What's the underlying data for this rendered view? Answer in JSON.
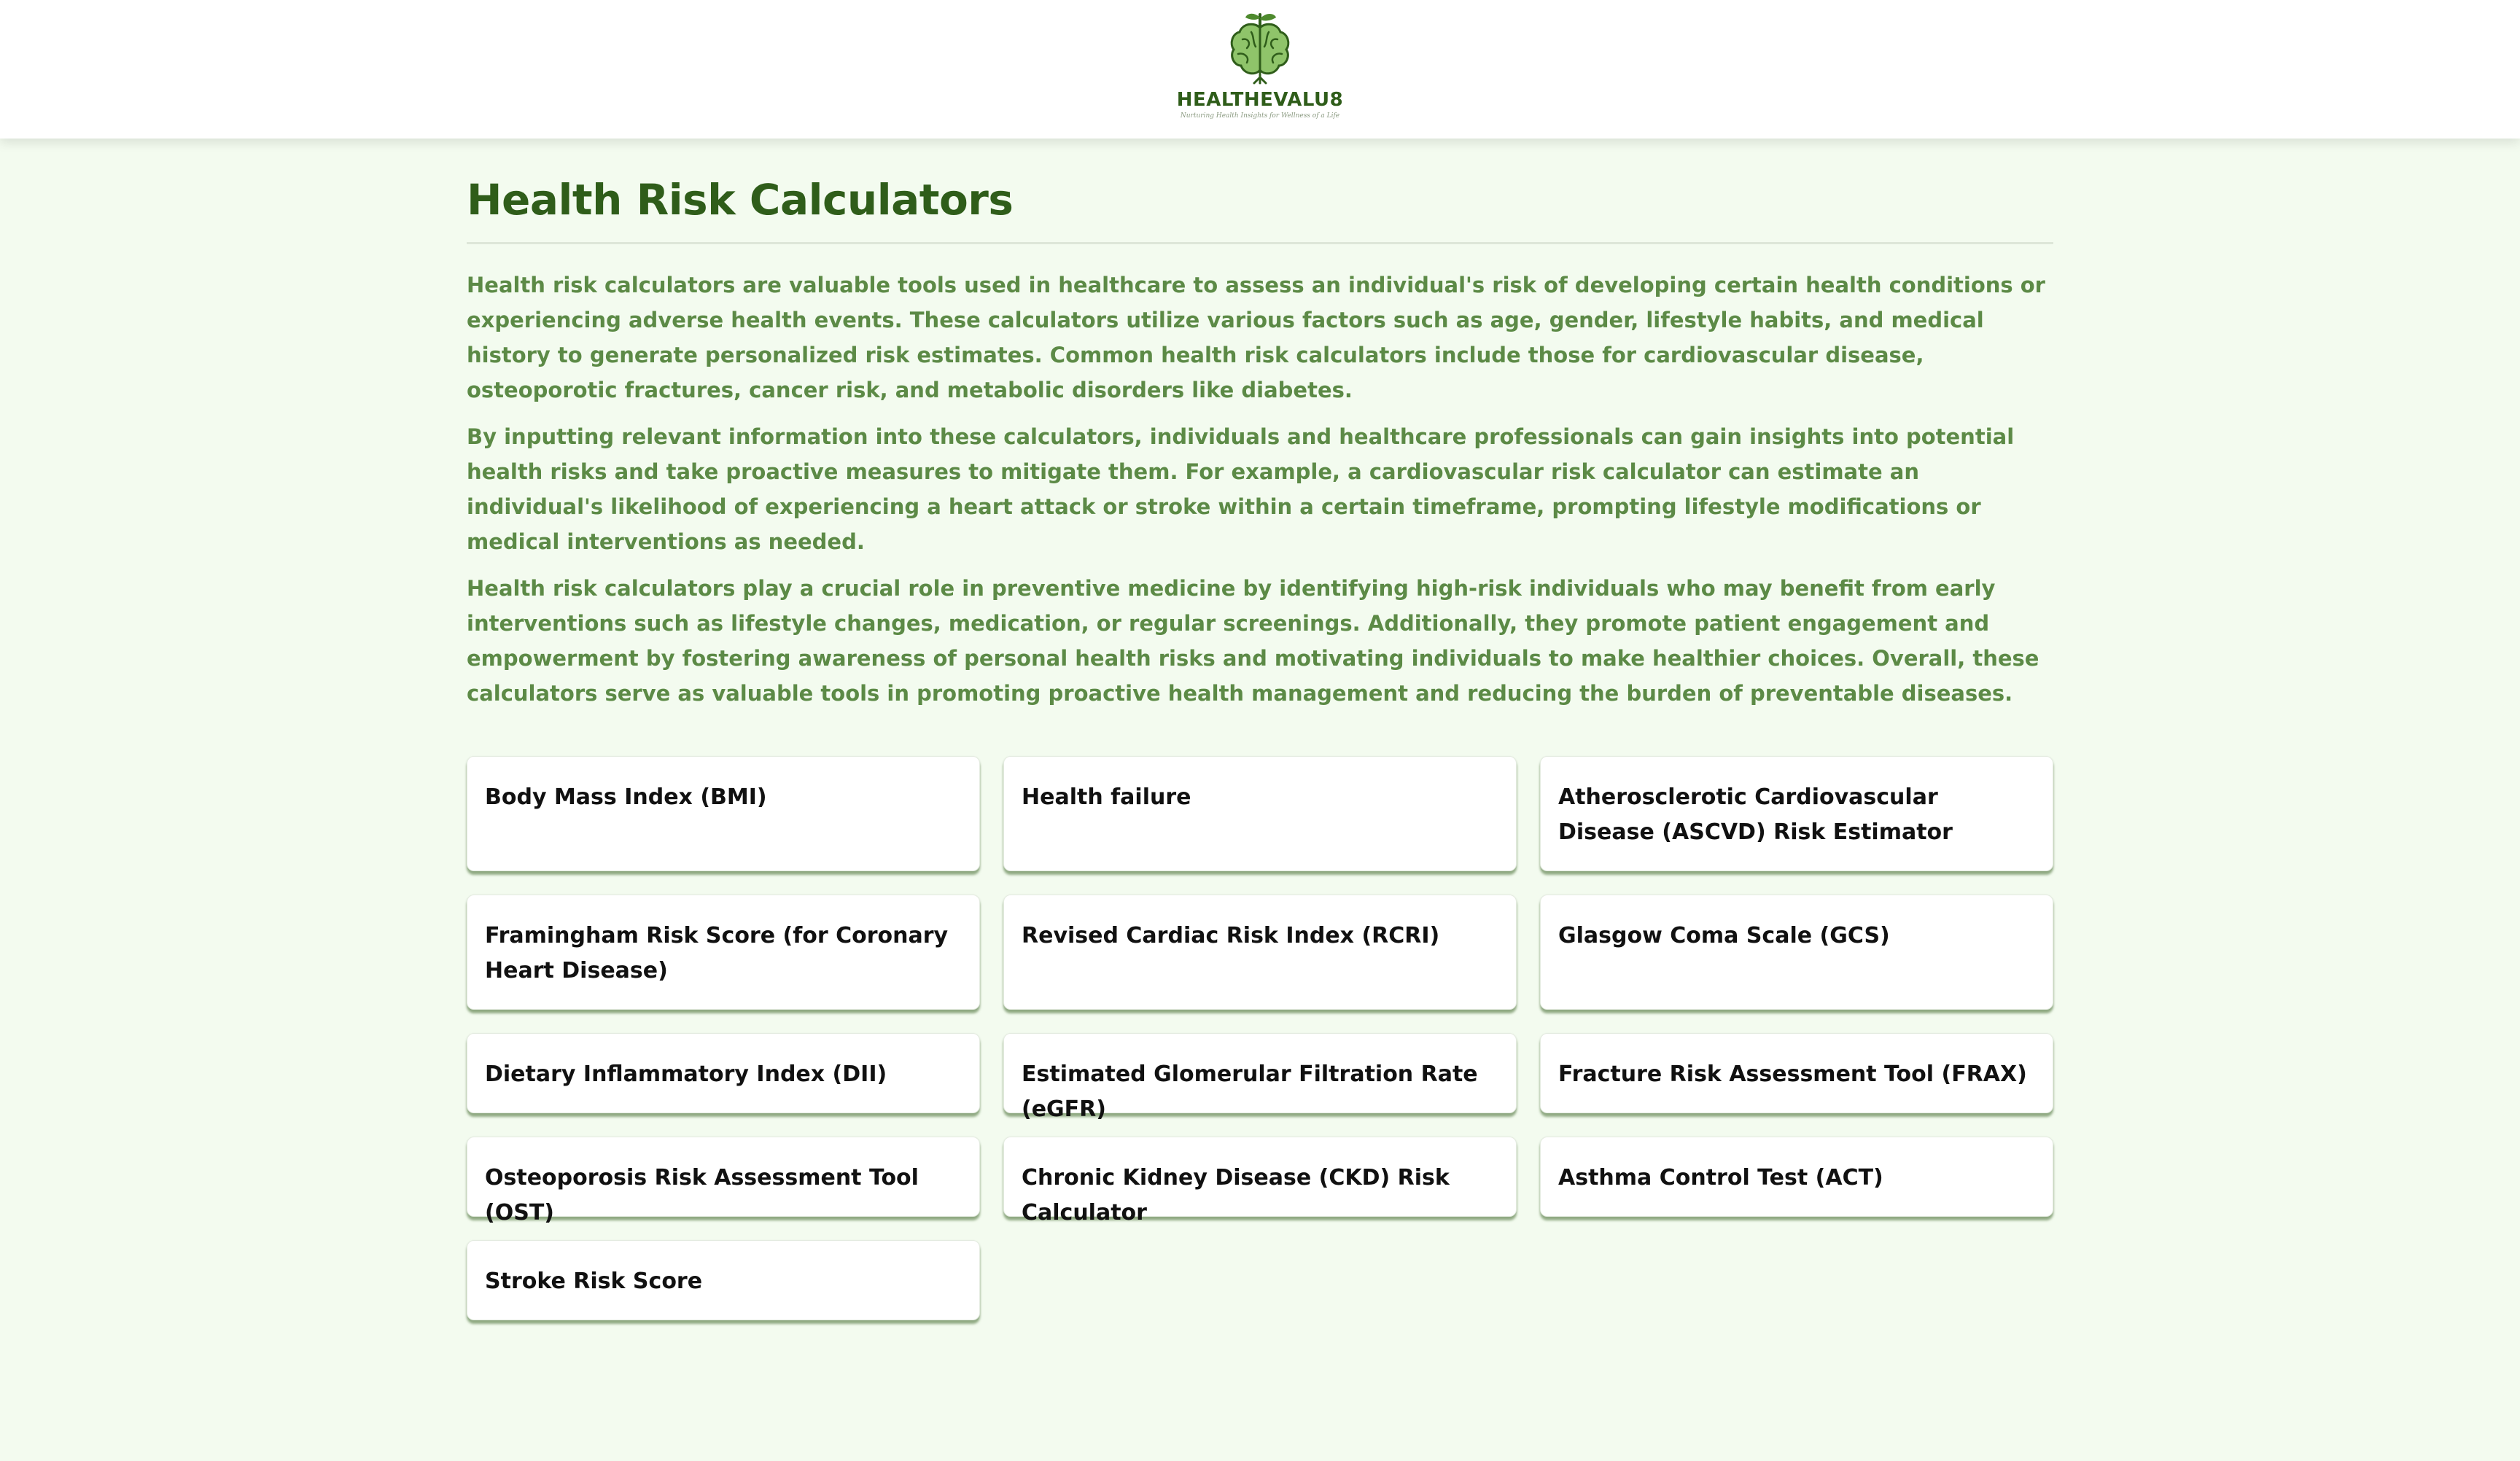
{
  "header": {
    "logo_name": "HEALTHEVALU8",
    "logo_tagline": "Nurturing Health Insights for Wellness of a Life"
  },
  "main": {
    "title": "Health Risk Calculators",
    "intro": [
      "Health risk calculators are valuable tools used in healthcare to assess an individual's risk of developing certain health conditions or experiencing adverse health events. These calculators utilize various factors such as age, gender, lifestyle habits, and medical history to generate personalized risk estimates. Common health risk calculators include those for cardiovascular disease, osteoporotic fractures, cancer risk, and metabolic disorders like diabetes.",
      "By inputting relevant information into these calculators, individuals and healthcare professionals can gain insights into potential health risks and take proactive measures to mitigate them. For example, a cardiovascular risk calculator can estimate an individual's likelihood of experiencing a heart attack or stroke within a certain timeframe, prompting lifestyle modifications or medical interventions as needed.",
      "Health risk calculators play a crucial role in preventive medicine by identifying high-risk individuals who may benefit from early interventions such as lifestyle changes, medication, or regular screenings. Additionally, they promote patient engagement and empowerment by fostering awareness of personal health risks and motivating individuals to make healthier choices. Overall, these calculators serve as valuable tools in promoting proactive health management and reducing the burden of preventable diseases."
    ],
    "calculators": [
      "Body Mass Index (BMI)",
      "Health failure",
      "Atherosclerotic Cardiovascular Disease (ASCVD) Risk Estimator",
      "Framingham Risk Score (for Coronary Heart Disease)",
      "Revised Cardiac Risk Index (RCRI)",
      "Glasgow Coma Scale (GCS)",
      "Dietary Inflammatory Index (DII)",
      "Estimated Glomerular Filtration Rate (eGFR)",
      "Fracture Risk Assessment Tool (FRAX)",
      "Osteoporosis Risk Assessment Tool (OST)",
      "Chronic Kidney Disease (CKD) Risk Calculator",
      "Asthma Control Test (ACT)",
      "Stroke Risk Score"
    ]
  },
  "colors": {
    "page_background": "#f3fbef",
    "brand_green": "#2f5d1a",
    "body_text_green": "#5c8a46",
    "card_background": "#ffffff"
  }
}
